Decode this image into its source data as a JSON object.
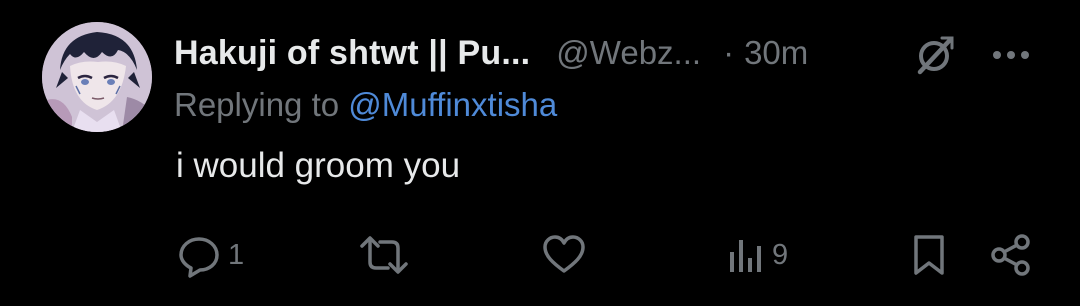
{
  "tweet": {
    "display_name": "Hakuji of shtwt || Pu...",
    "handle": "@Webz...",
    "separator": "·",
    "time": "30m",
    "replying_prefix": "Replying to ",
    "replying_to": "@Muffinxtisha",
    "text": "i would groom you"
  },
  "actions": {
    "reply_count": "1",
    "repost_count": "",
    "like_count": "",
    "views_count": "9"
  },
  "icons": {
    "grok": "grok-icon",
    "more": "more-icon",
    "reply": "reply-icon",
    "repost": "repost-icon",
    "like": "heart-icon",
    "views": "views-icon",
    "bookmark": "bookmark-icon",
    "share": "share-icon"
  },
  "colors": {
    "background": "#000000",
    "text": "#e7e9ea",
    "muted": "#71767b",
    "mention": "#4f8ad8"
  }
}
